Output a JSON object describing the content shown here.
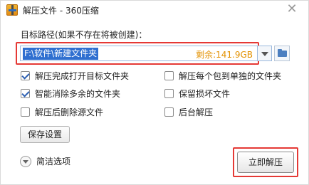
{
  "window": {
    "title": "解压文件 - 360压缩",
    "close_glyph": "✕"
  },
  "target": {
    "label": "目标路径(如果不存在将被创建)：",
    "path_value": "F:\\软件\\新建文件夹",
    "free_space": "剩余:141.9GB"
  },
  "options": {
    "left": [
      {
        "label": "解压完成打开目标文件夹",
        "checked": true
      },
      {
        "label": "智能消除多余的文件夹",
        "checked": true
      },
      {
        "label": "解压后删除源文件",
        "checked": false
      }
    ],
    "right": [
      {
        "label": "解压每个包到单独的文件夹",
        "checked": false
      },
      {
        "label": "保留损坏文件",
        "checked": false
      },
      {
        "label": "后台解压",
        "checked": false
      }
    ]
  },
  "buttons": {
    "save_settings": "保存设置",
    "simple_options": "简洁选项",
    "extract_now": "立即解压"
  },
  "colors": {
    "highlight": "#e53935",
    "selection": "#2f6fd0",
    "free_space": "#e39100"
  },
  "icons": {
    "app": "archive-icon",
    "close": "close-icon",
    "dropdown": "chevron-down-icon",
    "browse": "folder-icon",
    "collapse": "expand-circle-icon"
  }
}
